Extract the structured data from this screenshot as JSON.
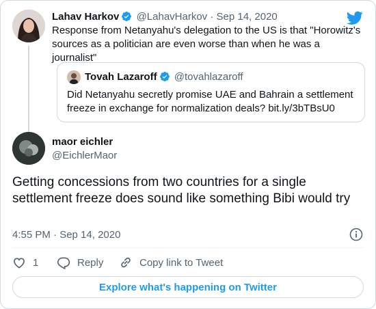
{
  "colors": {
    "accent": "#1d9bf0",
    "secondary_text": "#536471",
    "border": "#cfd9de",
    "text": "#0f1419"
  },
  "reply_to": {
    "name": "Lahav Harkov",
    "handle": "@LahavHarkov",
    "separator": "·",
    "date": "Sep 14, 2020",
    "text": "Response from Netanyahu's delegation to the US is that \"Horowitz's sources as a politician are even worse than when he was a journalist\""
  },
  "quoted_tweet": {
    "name": "Tovah Lazaroff",
    "handle": "@tovahlazaroff",
    "text": "Did Netanyahu secretly promise UAE and Bahrain a settlement freeze in exchange for normalization deals? bit.ly/3bTBsU0"
  },
  "author": {
    "name": "maor eichler",
    "handle": "@EichlerMaor"
  },
  "tweet": {
    "text": "Getting concessions from two countries for a single settlement freeze does sound like something Bibi would try",
    "timestamp": "4:55 PM · Sep 14, 2020"
  },
  "actions": {
    "like_count": "1",
    "reply_label": "Reply",
    "copy_link_label": "Copy link to Tweet"
  },
  "explore_label": "Explore what's happening on Twitter",
  "icons": [
    "twitter-bird-icon",
    "verified-badge-icon",
    "info-icon",
    "heart-icon",
    "reply-bubble-icon",
    "link-icon"
  ]
}
